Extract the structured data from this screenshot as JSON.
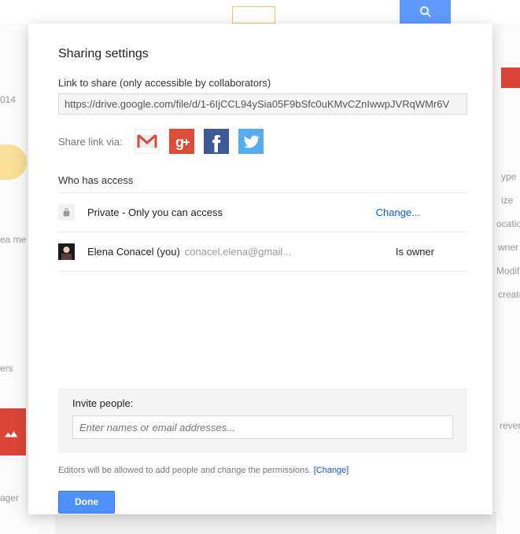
{
  "bg": {
    "details": [
      "ype",
      "ize",
      "ocation",
      "wner",
      "Modified",
      "create"
    ],
    "labels": [
      "014",
      "ea me",
      "ers",
      "ager",
      "reven"
    ]
  },
  "dialog": {
    "title": "Sharing settings",
    "link_label": "Link to share (only accessible by collaborators)",
    "link_url": "https://drive.google.com/file/d/1-6IjCCL94ySia05F9bSfc0uKMvCZnIwwpJVRqWMr6V",
    "share_via_label": "Share link via:",
    "who_header": "Who has access",
    "private_text": "Private - Only you can access",
    "change_label": "Change...",
    "owner_name": "Elena Conacel (you)",
    "owner_email": "conacel.elena@gmail...",
    "owner_role": "Is owner",
    "invite_label": "Invite people:",
    "invite_placeholder": "Enter names or email addresses...",
    "perm_note_text": "Editors will be allowed to add people and change the permissions.  ",
    "perm_note_change": "[Change]",
    "done_label": "Done"
  }
}
